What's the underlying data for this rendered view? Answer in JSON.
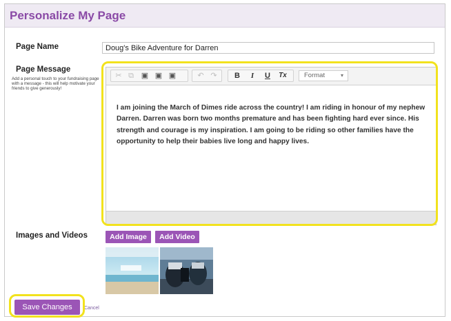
{
  "header": {
    "title": "Personalize My Page"
  },
  "fields": {
    "page_name_label": "Page Name",
    "page_name_value": "Doug's Bike Adventure for Darren",
    "page_message_label": "Page Message",
    "page_message_help": "Add a personal touch to your fundraising page with a message - this will help motivate your friends to give generously!",
    "images_label": "Images and Videos"
  },
  "toolbar": {
    "bold_label": "B",
    "italic_label": "I",
    "underline_label": "U",
    "clear_format_label": "Tx",
    "format_select_value": "Format",
    "icons": [
      "cut-icon",
      "copy-icon",
      "paste-icon",
      "paste-text-icon",
      "paste-word-icon",
      "undo-icon",
      "redo-icon"
    ]
  },
  "editor": {
    "message": "I am joining the March of Dimes ride across the country! I am riding in honour of my nephew Darren. Darren was born two months premature and has been fighting hard ever since.  His strength and courage is my inspiration.  I am going to be riding so other families have the opportunity to help their babies live long and happy lives."
  },
  "media": {
    "add_image_label": "Add Image",
    "add_video_label": "Add Video"
  },
  "actions": {
    "save_label": "Save Changes",
    "cancel_label": "Cancel"
  },
  "colors": {
    "accent": "#9b55b6",
    "title": "#8a4aa6",
    "highlight": "#f2e21d"
  }
}
